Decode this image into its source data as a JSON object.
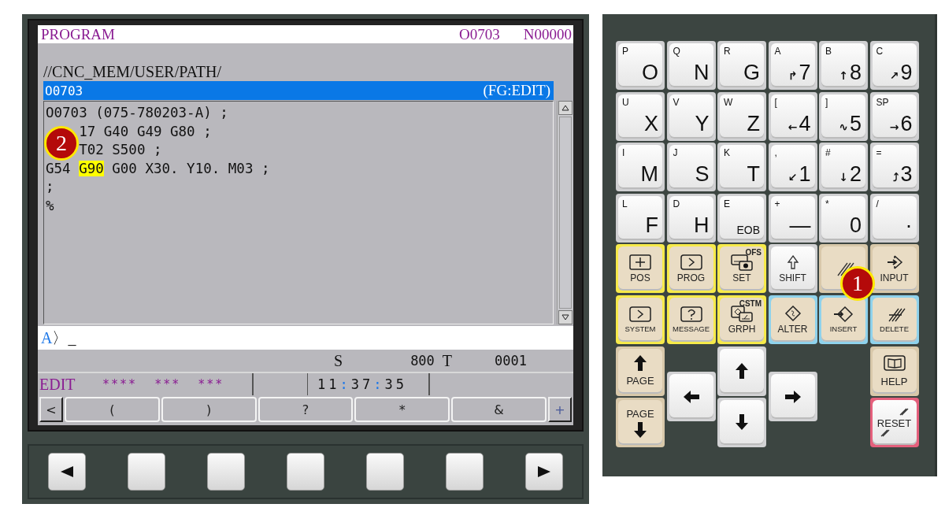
{
  "screen": {
    "title": "PROGRAM",
    "program_number": "O0703",
    "sequence_number": "N00000",
    "path": "//CNC_MEM/USER/PATH/",
    "file_bar": {
      "name": "O0703",
      "mode": "(FG:EDIT)"
    },
    "code_lines": [
      [
        {
          "text": "O0703 (075-780203-A) ;"
        }
      ],
      [
        {
          "text": "    17 G40 G49 G80 ;"
        }
      ],
      [
        {
          "text": "    T02 S500 ;"
        }
      ],
      [
        {
          "text": "G54 "
        },
        {
          "text": "G90",
          "highlight": true
        },
        {
          "text": " G00 X30. Y10. M03 ;"
        }
      ],
      [
        {
          "text": ";"
        }
      ],
      [
        {
          "text": "%"
        }
      ]
    ],
    "input_line": {
      "prompt": "A",
      "value": "〉_"
    },
    "status": {
      "spindle_label": "S",
      "spindle_value": "800",
      "tool_label": "T",
      "tool_value": "0001"
    },
    "mode_row": {
      "mode": "EDIT",
      "fields": [
        "****",
        "***",
        "***"
      ],
      "time": "11:37:35"
    },
    "softkeys": [
      {
        "label": "<",
        "kind": "edge"
      },
      {
        "label": "(",
        "kind": "soft"
      },
      {
        "label": ")",
        "kind": "soft"
      },
      {
        "label": "?",
        "kind": "soft"
      },
      {
        "label": "*",
        "kind": "soft"
      },
      {
        "label": "&",
        "kind": "soft"
      },
      {
        "label": "+",
        "kind": "edge"
      }
    ]
  },
  "hard_softkeys": [
    {
      "kind": "prev"
    },
    {
      "kind": "blank"
    },
    {
      "kind": "blank"
    },
    {
      "kind": "blank"
    },
    {
      "kind": "blank"
    },
    {
      "kind": "blank"
    },
    {
      "kind": "next"
    }
  ],
  "keypad": {
    "char_keys": [
      {
        "sub": "P",
        "main": "O",
        "kind": "letter"
      },
      {
        "sub": "Q",
        "main": "N",
        "kind": "letter"
      },
      {
        "sub": "R",
        "main": "G",
        "kind": "letter"
      },
      {
        "sub": "A",
        "arrow": "↱",
        "main": "7",
        "kind": "digit"
      },
      {
        "sub": "B",
        "arrow": "↑",
        "main": "8",
        "kind": "digit"
      },
      {
        "sub": "C",
        "arrow": "↗",
        "main": "9",
        "kind": "digit"
      },
      {
        "sub": "U",
        "main": "X",
        "kind": "letter"
      },
      {
        "sub": "V",
        "main": "Y",
        "kind": "letter"
      },
      {
        "sub": "W",
        "main": "Z",
        "kind": "letter"
      },
      {
        "sub": "[",
        "arrow": "←",
        "main": "4",
        "kind": "digit"
      },
      {
        "sub": "]",
        "arrow": "∿",
        "main": "5",
        "kind": "digit"
      },
      {
        "sub": "SP",
        "arrow": "→",
        "main": "6",
        "kind": "digit"
      },
      {
        "sub": "I",
        "main": "M",
        "kind": "letter"
      },
      {
        "sub": "J",
        "main": "S",
        "kind": "letter"
      },
      {
        "sub": "K",
        "main": "T",
        "kind": "letter"
      },
      {
        "sub": ",",
        "arrow": "↙",
        "main": "1",
        "kind": "digit"
      },
      {
        "sub": "#",
        "arrow": "↓",
        "main": "2",
        "kind": "digit"
      },
      {
        "sub": "=",
        "arrow": "⤴",
        "main": "3",
        "kind": "digit"
      },
      {
        "sub": "L",
        "main": "F",
        "kind": "letter"
      },
      {
        "sub": "D",
        "main": "H",
        "kind": "letter"
      },
      {
        "sub": "E",
        "main": "EOB",
        "kind": "word"
      },
      {
        "sub": "+",
        "main": "—",
        "kind": "digit"
      },
      {
        "sub": "*",
        "main": "0",
        "kind": "digit"
      },
      {
        "sub": "/",
        "main": "·",
        "kind": "digit"
      }
    ],
    "function_keys": [
      {
        "label": "POS",
        "color": "#f6ea4a",
        "kind": "tan"
      },
      {
        "label": "PROG",
        "color": "#f6ea4a",
        "kind": "tan"
      },
      {
        "label": "SET",
        "tag": "OFS",
        "color": "#f6ea4a",
        "kind": "tan"
      },
      {
        "label": "SHIFT",
        "color": "#d2d2d4",
        "kind": "light"
      },
      {
        "color": "#d8c8aa",
        "kind": "tan"
      },
      {
        "label": "INPUT",
        "color": "#d8c8aa",
        "kind": "tan"
      },
      {
        "label": "SYSTEM",
        "color": "#f6ea4a",
        "kind": "tan"
      },
      {
        "label": "MESSAGE",
        "color": "#f6ea4a",
        "kind": "tan"
      },
      {
        "label": "GRPH",
        "tag": "CSTM",
        "color": "#f6ea4a",
        "kind": "tan"
      },
      {
        "label": "ALTER",
        "color": "#8fd2ec",
        "kind": "tan"
      },
      {
        "label": "INSERT",
        "color": "#8fd2ec",
        "kind": "tan"
      },
      {
        "label": "DELETE",
        "color": "#8fd2ec",
        "kind": "tan"
      }
    ],
    "nav_keys": [
      {
        "kind": "page-up",
        "label": "PAGE",
        "color": "#d8c8aa"
      },
      {
        "kind": "left",
        "color": "#d2d2d4"
      },
      {
        "kind": "up",
        "color": "#d2d2d4"
      },
      {
        "kind": "right",
        "color": "#d2d2d4"
      },
      {
        "kind": "help",
        "label": "HELP",
        "color": "#d8c8aa"
      },
      {
        "kind": "page-down",
        "label": "PAGE",
        "color": "#d8c8aa"
      },
      {
        "kind": "down",
        "color": "#d2d2d4"
      },
      {
        "kind": "reset",
        "label": "RESET",
        "color": "#e4607c"
      }
    ]
  },
  "callouts": [
    {
      "label": "1",
      "kind": "keypad"
    },
    {
      "label": "2",
      "kind": "editor"
    }
  ]
}
